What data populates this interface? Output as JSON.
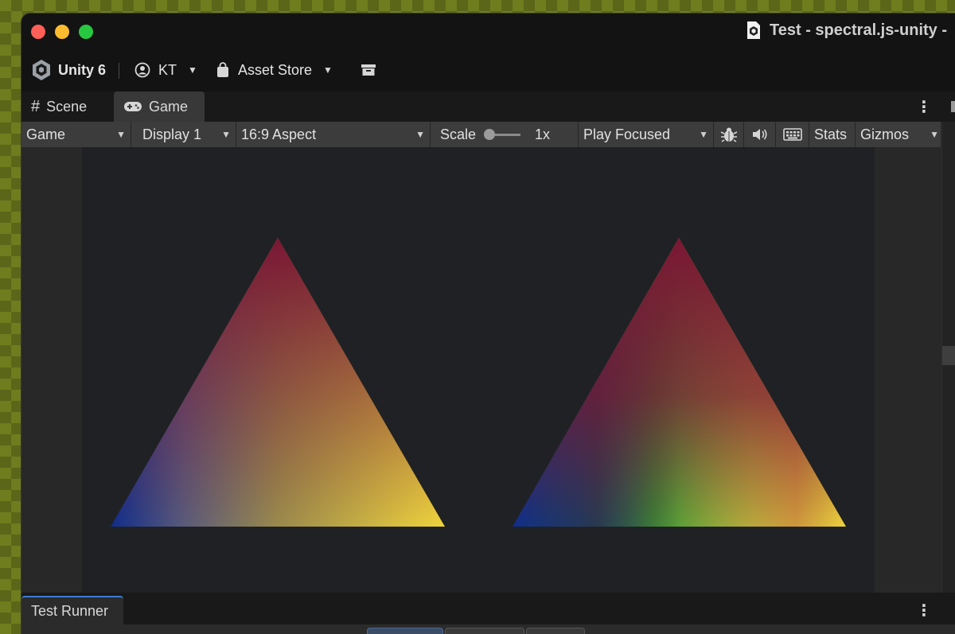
{
  "window": {
    "title": "Test - spectral.js-unity -"
  },
  "toolbar": {
    "unity_label": "Unity 6",
    "account_label": "KT",
    "asset_store_label": "Asset Store"
  },
  "tabs": {
    "scene": "Scene",
    "game": "Game"
  },
  "game_toolbar": {
    "view_mode": "Game",
    "display": "Display 1",
    "aspect": "16:9 Aspect",
    "scale_label": "Scale",
    "scale_value": "1x",
    "play_mode": "Play Focused",
    "stats": "Stats",
    "gizmos": "Gizmos"
  },
  "bottom_panel": {
    "tab": "Test Runner"
  },
  "colors": {
    "triangle_top": "#7a1734",
    "triangle_left": "#0f2d8c",
    "triangle_right": "#f0d43c",
    "mix_left_triangle": "#9a7a3a",
    "mix_right_triangle_green": "#3f8f35"
  },
  "icons": [
    "document-icon",
    "unity-logo-icon",
    "account-icon",
    "shopping-bag-icon",
    "archive-icon",
    "grid-icon",
    "gamepad-icon",
    "bug-icon",
    "audio-icon",
    "keyboard-icon",
    "kebab-icon"
  ]
}
